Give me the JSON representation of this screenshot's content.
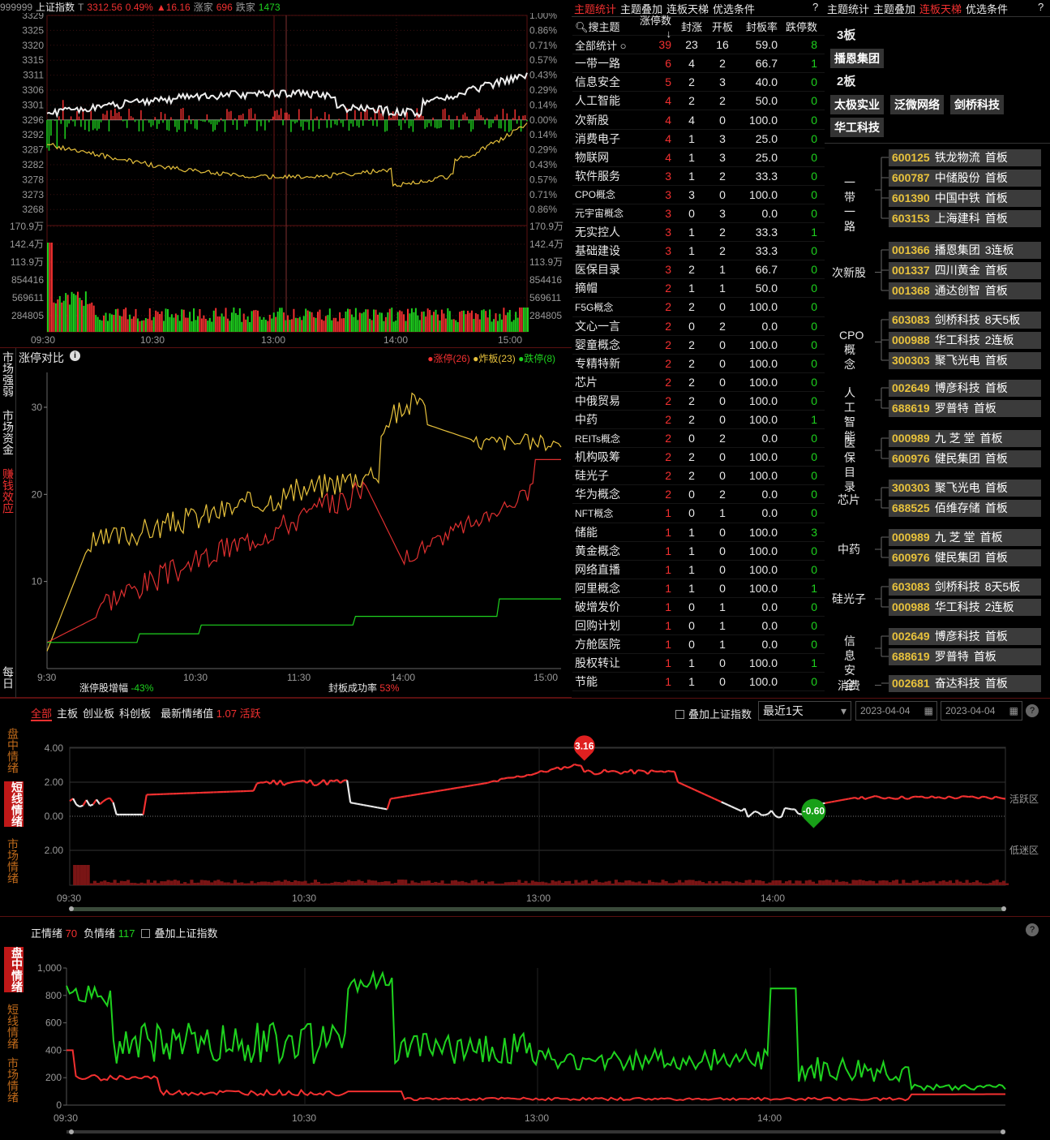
{
  "index_header": {
    "code": "999999",
    "name": "上证指数",
    "t_label": "T",
    "price": "3312.56",
    "pct": "0.49%",
    "change": "▲16.16",
    "up_label": "涨家",
    "up_count": "696",
    "down_label": "跌家",
    "down_count": "1473"
  },
  "price_axis_left": [
    "3329",
    "3325",
    "3320",
    "3315",
    "3311",
    "3306",
    "3301",
    "3296",
    "3292",
    "3287",
    "3282",
    "3278",
    "3273",
    "3268"
  ],
  "price_axis_right": [
    "1.00%",
    "0.86%",
    "0.71%",
    "0.57%",
    "0.43%",
    "0.29%",
    "0.14%",
    "0.00%",
    "0.14%",
    "0.29%",
    "0.43%",
    "0.57%",
    "0.71%",
    "0.86%"
  ],
  "vol_axis": [
    "170.9万",
    "142.4万",
    "113.9万",
    "854416",
    "569611",
    "284805"
  ],
  "time_axis": [
    "09:30",
    "10:30",
    "13:00",
    "14:00",
    "15:00"
  ],
  "side_tabs": [
    {
      "label": "市场强弱"
    },
    {
      "label": "市场资金"
    },
    {
      "label": "赚钱效应"
    },
    {
      "label": "每日"
    }
  ],
  "limit_chart": {
    "title": "涨停对比",
    "legend": [
      {
        "label": "涨停(26)",
        "color": "#f23030"
      },
      {
        "label": "炸板(23)",
        "color": "#e8c23c"
      },
      {
        "label": "跌停(8)",
        "color": "#1ed21e"
      }
    ],
    "y_ticks": [
      "30",
      "20",
      "10"
    ],
    "x_ticks": [
      "9:30",
      "10:30",
      "11:30",
      "14:00",
      "15:00"
    ],
    "footer_left_label": "涨停股增幅",
    "footer_left_value": "-43%",
    "footer_right_label": "封板成功率",
    "footer_right_value": "53%"
  },
  "theme_tabs": [
    "主题统计",
    "主题叠加",
    "连板天梯",
    "优选条件"
  ],
  "theme_table": {
    "headers": [
      "搜主题",
      "涨停数↓",
      "封涨",
      "开板",
      "封板率",
      "跌停数"
    ],
    "summary": {
      "name": "全部统计",
      "up": "39",
      "seal": "23",
      "open": "16",
      "rate": "59.0",
      "down": "8"
    },
    "rows": [
      {
        "name": "一带一路",
        "up": "6",
        "seal": "4",
        "open": "2",
        "rate": "66.7",
        "down": "1"
      },
      {
        "name": "信息安全",
        "up": "5",
        "seal": "2",
        "open": "3",
        "rate": "40.0",
        "down": "0"
      },
      {
        "name": "人工智能",
        "up": "4",
        "seal": "2",
        "open": "2",
        "rate": "50.0",
        "down": "0"
      },
      {
        "name": "次新股",
        "up": "4",
        "seal": "4",
        "open": "0",
        "rate": "100.0",
        "down": "0"
      },
      {
        "name": "消费电子",
        "up": "4",
        "seal": "1",
        "open": "3",
        "rate": "25.0",
        "down": "0"
      },
      {
        "name": "物联网",
        "up": "4",
        "seal": "1",
        "open": "3",
        "rate": "25.0",
        "down": "0"
      },
      {
        "name": "软件服务",
        "up": "3",
        "seal": "1",
        "open": "2",
        "rate": "33.3",
        "down": "0"
      },
      {
        "name": "CPO概念",
        "up": "3",
        "seal": "3",
        "open": "0",
        "rate": "100.0",
        "down": "0"
      },
      {
        "name": "元宇宙概念",
        "up": "3",
        "seal": "0",
        "open": "3",
        "rate": "0.0",
        "down": "0"
      },
      {
        "name": "无实控人",
        "up": "3",
        "seal": "1",
        "open": "2",
        "rate": "33.3",
        "down": "1"
      },
      {
        "name": "基础建设",
        "up": "3",
        "seal": "1",
        "open": "2",
        "rate": "33.3",
        "down": "0"
      },
      {
        "name": "医保目录",
        "up": "3",
        "seal": "2",
        "open": "1",
        "rate": "66.7",
        "down": "0"
      },
      {
        "name": "摘帽",
        "up": "2",
        "seal": "1",
        "open": "1",
        "rate": "50.0",
        "down": "0"
      },
      {
        "name": "F5G概念",
        "up": "2",
        "seal": "2",
        "open": "0",
        "rate": "100.0",
        "down": "0"
      },
      {
        "name": "文心一言",
        "up": "2",
        "seal": "0",
        "open": "2",
        "rate": "0.0",
        "down": "0"
      },
      {
        "name": "婴童概念",
        "up": "2",
        "seal": "2",
        "open": "0",
        "rate": "100.0",
        "down": "0"
      },
      {
        "name": "专精特新",
        "up": "2",
        "seal": "2",
        "open": "0",
        "rate": "100.0",
        "down": "0"
      },
      {
        "name": "芯片",
        "up": "2",
        "seal": "2",
        "open": "0",
        "rate": "100.0",
        "down": "0"
      },
      {
        "name": "中俄贸易",
        "up": "2",
        "seal": "2",
        "open": "0",
        "rate": "100.0",
        "down": "0"
      },
      {
        "name": "中药",
        "up": "2",
        "seal": "2",
        "open": "0",
        "rate": "100.0",
        "down": "1"
      },
      {
        "name": "REITs概念",
        "up": "2",
        "seal": "0",
        "open": "2",
        "rate": "0.0",
        "down": "0"
      },
      {
        "name": "机构吸筹",
        "up": "2",
        "seal": "2",
        "open": "0",
        "rate": "100.0",
        "down": "0"
      },
      {
        "name": "硅光子",
        "up": "2",
        "seal": "2",
        "open": "0",
        "rate": "100.0",
        "down": "0"
      },
      {
        "name": "华为概念",
        "up": "2",
        "seal": "0",
        "open": "2",
        "rate": "0.0",
        "down": "0"
      },
      {
        "name": "NFT概念",
        "up": "1",
        "seal": "0",
        "open": "1",
        "rate": "0.0",
        "down": "0"
      },
      {
        "name": "储能",
        "up": "1",
        "seal": "1",
        "open": "0",
        "rate": "100.0",
        "down": "3"
      },
      {
        "name": "黄金概念",
        "up": "1",
        "seal": "1",
        "open": "0",
        "rate": "100.0",
        "down": "0"
      },
      {
        "name": "网络直播",
        "up": "1",
        "seal": "1",
        "open": "0",
        "rate": "100.0",
        "down": "0"
      },
      {
        "name": "阿里概念",
        "up": "1",
        "seal": "1",
        "open": "0",
        "rate": "100.0",
        "down": "1"
      },
      {
        "name": "破增发价",
        "up": "1",
        "seal": "0",
        "open": "1",
        "rate": "0.0",
        "down": "0"
      },
      {
        "name": "回购计划",
        "up": "1",
        "seal": "0",
        "open": "1",
        "rate": "0.0",
        "down": "0"
      },
      {
        "name": "方舱医院",
        "up": "1",
        "seal": "0",
        "open": "1",
        "rate": "0.0",
        "down": "0"
      },
      {
        "name": "股权转让",
        "up": "1",
        "seal": "1",
        "open": "0",
        "rate": "100.0",
        "down": "1"
      },
      {
        "name": "节能",
        "up": "1",
        "seal": "1",
        "open": "0",
        "rate": "100.0",
        "down": "0"
      }
    ]
  },
  "ladder": {
    "board3_label": "3板",
    "board3": [
      "播恩集团"
    ],
    "board2_label": "2板",
    "board2": [
      "太极实业",
      "泛微网络",
      "剑桥科技",
      "华工科技"
    ],
    "groups": [
      {
        "label": "一带一路",
        "stocks": [
          {
            "code": "600125",
            "name": "铁龙物流",
            "tag": "首板"
          },
          {
            "code": "600787",
            "name": "中储股份",
            "tag": "首板"
          },
          {
            "code": "601390",
            "name": "中国中铁",
            "tag": "首板"
          },
          {
            "code": "603153",
            "name": "上海建科",
            "tag": "首板"
          }
        ]
      },
      {
        "label": "次新股",
        "stocks": [
          {
            "code": "001366",
            "name": "播恩集团",
            "tag": "3连板"
          },
          {
            "code": "001337",
            "name": "四川黄金",
            "tag": "首板"
          },
          {
            "code": "001368",
            "name": "通达创智",
            "tag": "首板"
          }
        ]
      },
      {
        "label": "CPO概念",
        "stocks": [
          {
            "code": "603083",
            "name": "剑桥科技",
            "tag": "8天5板"
          },
          {
            "code": "000988",
            "name": "华工科技",
            "tag": "2连板"
          },
          {
            "code": "300303",
            "name": "聚飞光电",
            "tag": "首板"
          }
        ]
      },
      {
        "label": "人工智能",
        "stocks": [
          {
            "code": "002649",
            "name": "博彦科技",
            "tag": "首板"
          },
          {
            "code": "688619",
            "name": "罗普特",
            "tag": "首板"
          }
        ]
      },
      {
        "label": "医保目录",
        "stocks": [
          {
            "code": "000989",
            "name": "九 芝 堂",
            "tag": "首板"
          },
          {
            "code": "600976",
            "name": "健民集团",
            "tag": "首板"
          }
        ]
      },
      {
        "label": "芯片",
        "stocks": [
          {
            "code": "300303",
            "name": "聚飞光电",
            "tag": "首板"
          },
          {
            "code": "688525",
            "name": "佰维存储",
            "tag": "首板"
          }
        ]
      },
      {
        "label": "中药",
        "stocks": [
          {
            "code": "000989",
            "name": "九 芝 堂",
            "tag": "首板"
          },
          {
            "code": "600976",
            "name": "健民集团",
            "tag": "首板"
          }
        ]
      },
      {
        "label": "硅光子",
        "stocks": [
          {
            "code": "603083",
            "name": "剑桥科技",
            "tag": "8天5板"
          },
          {
            "code": "000988",
            "name": "华工科技",
            "tag": "2连板"
          }
        ]
      },
      {
        "label": "信息安全",
        "stocks": [
          {
            "code": "002649",
            "name": "博彦科技",
            "tag": "首板"
          },
          {
            "code": "688619",
            "name": "罗普特",
            "tag": "首板"
          }
        ]
      },
      {
        "label": "消费",
        "stocks": [
          {
            "code": "002681",
            "name": "奋达科技",
            "tag": "首板"
          }
        ]
      }
    ]
  },
  "sentiment": {
    "filter_tabs": [
      "全部",
      "主板",
      "创业板",
      "科创板"
    ],
    "latest_label": "最新情绪值",
    "latest_value": "1.07",
    "latest_state": "活跃",
    "overlay_label": "叠加上证指数",
    "range_select": "最近1天",
    "date_from": "2023-04-04",
    "date_to": "2023-04-04",
    "side_tabs": [
      "盘中情绪",
      "短线情绪",
      "市场情绪"
    ],
    "y_ticks": [
      "4.00",
      "2.00",
      "0.00",
      "2.00"
    ],
    "zone_high": "活跃区",
    "zone_low": "低迷区",
    "peak_max": "3.16",
    "peak_min": "-0.60",
    "x_ticks": [
      "09:30",
      "10:30",
      "13:00",
      "14:00"
    ]
  },
  "emotion": {
    "pos_label": "正情绪",
    "pos_value": "70",
    "neg_label": "负情绪",
    "neg_value": "117",
    "overlay_label": "叠加上证指数",
    "side_tabs": [
      "盘中情绪",
      "短线情绪",
      "市场情绪"
    ],
    "y_ticks": [
      "1,000",
      "800",
      "600",
      "400",
      "200",
      "0"
    ],
    "x_ticks": [
      "09:30",
      "10:30",
      "13:00",
      "14:00"
    ]
  },
  "colors": {
    "up": "#f23030",
    "down": "#1ed21e",
    "flash": "#e8c23c",
    "bg": "#000000",
    "grid": "#3a1010"
  }
}
